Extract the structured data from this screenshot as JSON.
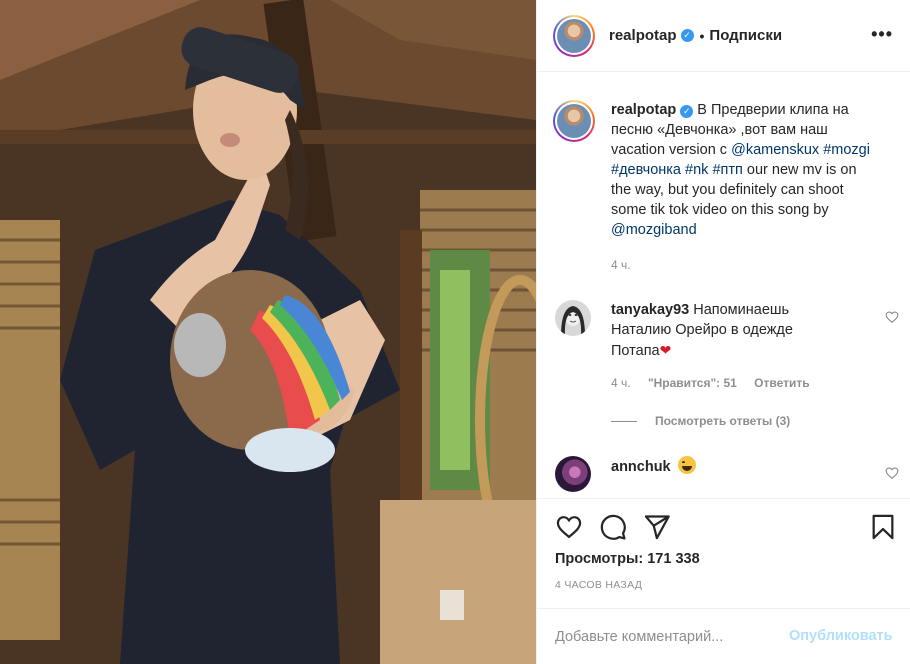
{
  "post": {
    "username": "realpotap",
    "verified_mark": "✓",
    "dot": "•",
    "follow_label": "Подписки",
    "more_label": "•••"
  },
  "caption": {
    "username": "realpotap",
    "verified_mark": "✓",
    "text_1": " В Предверии клипа на песню «Девчонка» ,вот вам наш vacation version с ",
    "mention_1": "@kamenskux",
    "space_1": " ",
    "tag_1": "#mozgi",
    "space_2": " ",
    "tag_2": "#девчонка",
    "space_3": " ",
    "tag_3": "#nk",
    "space_4": " ",
    "tag_4": "#птп",
    "text_2": " our new mv is on the way, but you definitely can shoot some tik tok video on this song by ",
    "mention_2": "@mozgiband",
    "time": "4 ч."
  },
  "comments": [
    {
      "username": "tanyakay93",
      "text": " Напоминаешь Наталию Орейро в одежде Потапа",
      "heart": "❤",
      "time": "4 ч.",
      "likes": "\"Нравится\": 51",
      "reply_label": "Ответить"
    },
    {
      "username": "annchuk",
      "text": " "
    }
  ],
  "view_replies": "Посмотреть ответы (3)",
  "actions": {
    "icons": [
      "heart-outline-icon",
      "comment-bubble-icon",
      "share-paper-plane-icon",
      "bookmark-icon"
    ],
    "views_label": "Просмотры: 171 338",
    "when": "4 часов назад"
  },
  "add_comment": {
    "placeholder": "Добавьте комментарий...",
    "post_label": "Опубликовать"
  },
  "colors": {
    "link": "#00376b",
    "muted": "#8e8e8e",
    "post_disabled": "#b2dffc",
    "verified": "#3897f0"
  }
}
